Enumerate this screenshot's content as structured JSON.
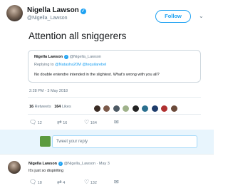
{
  "tweet": {
    "author_name": "Nigella Lawson",
    "author_handle": "@Nigella_Lawson",
    "follow_label": "Follow",
    "text": "Attention all sniggerers",
    "timestamp": "2:28 PM - 3 May 2018",
    "retweets_count": "16",
    "retweets_label": "Retweets",
    "likes_count": "164",
    "likes_label": "Likes",
    "actions": {
      "replies": "12",
      "retweets": "16",
      "likes": "164"
    }
  },
  "quoted_tweet": {
    "author_name": "Nigella Lawson",
    "author_handle": "@Nigella_Lawson",
    "replying_prefix": "Replying to",
    "replying_to": "@Natasha20M @tequilarebel",
    "text": "No double entendre intended in the slightest. What's wrong with you all?"
  },
  "reply_composer": {
    "placeholder": "Tweet your reply"
  },
  "reply_tweet": {
    "author_name": "Nigella Lawson",
    "author_handle": "@Nigella_Lawson",
    "date": "· May 3",
    "text": "It's just so dispiriting",
    "actions": {
      "replies": "18",
      "retweets": "4",
      "likes": "132"
    }
  },
  "colors": {
    "accent": "#1da1f2",
    "muted": "#657786",
    "border": "#e6ecf0"
  },
  "icons": [
    "verified-icon",
    "chevron-down-icon",
    "reply-icon",
    "retweet-icon",
    "heart-icon",
    "message-icon"
  ]
}
